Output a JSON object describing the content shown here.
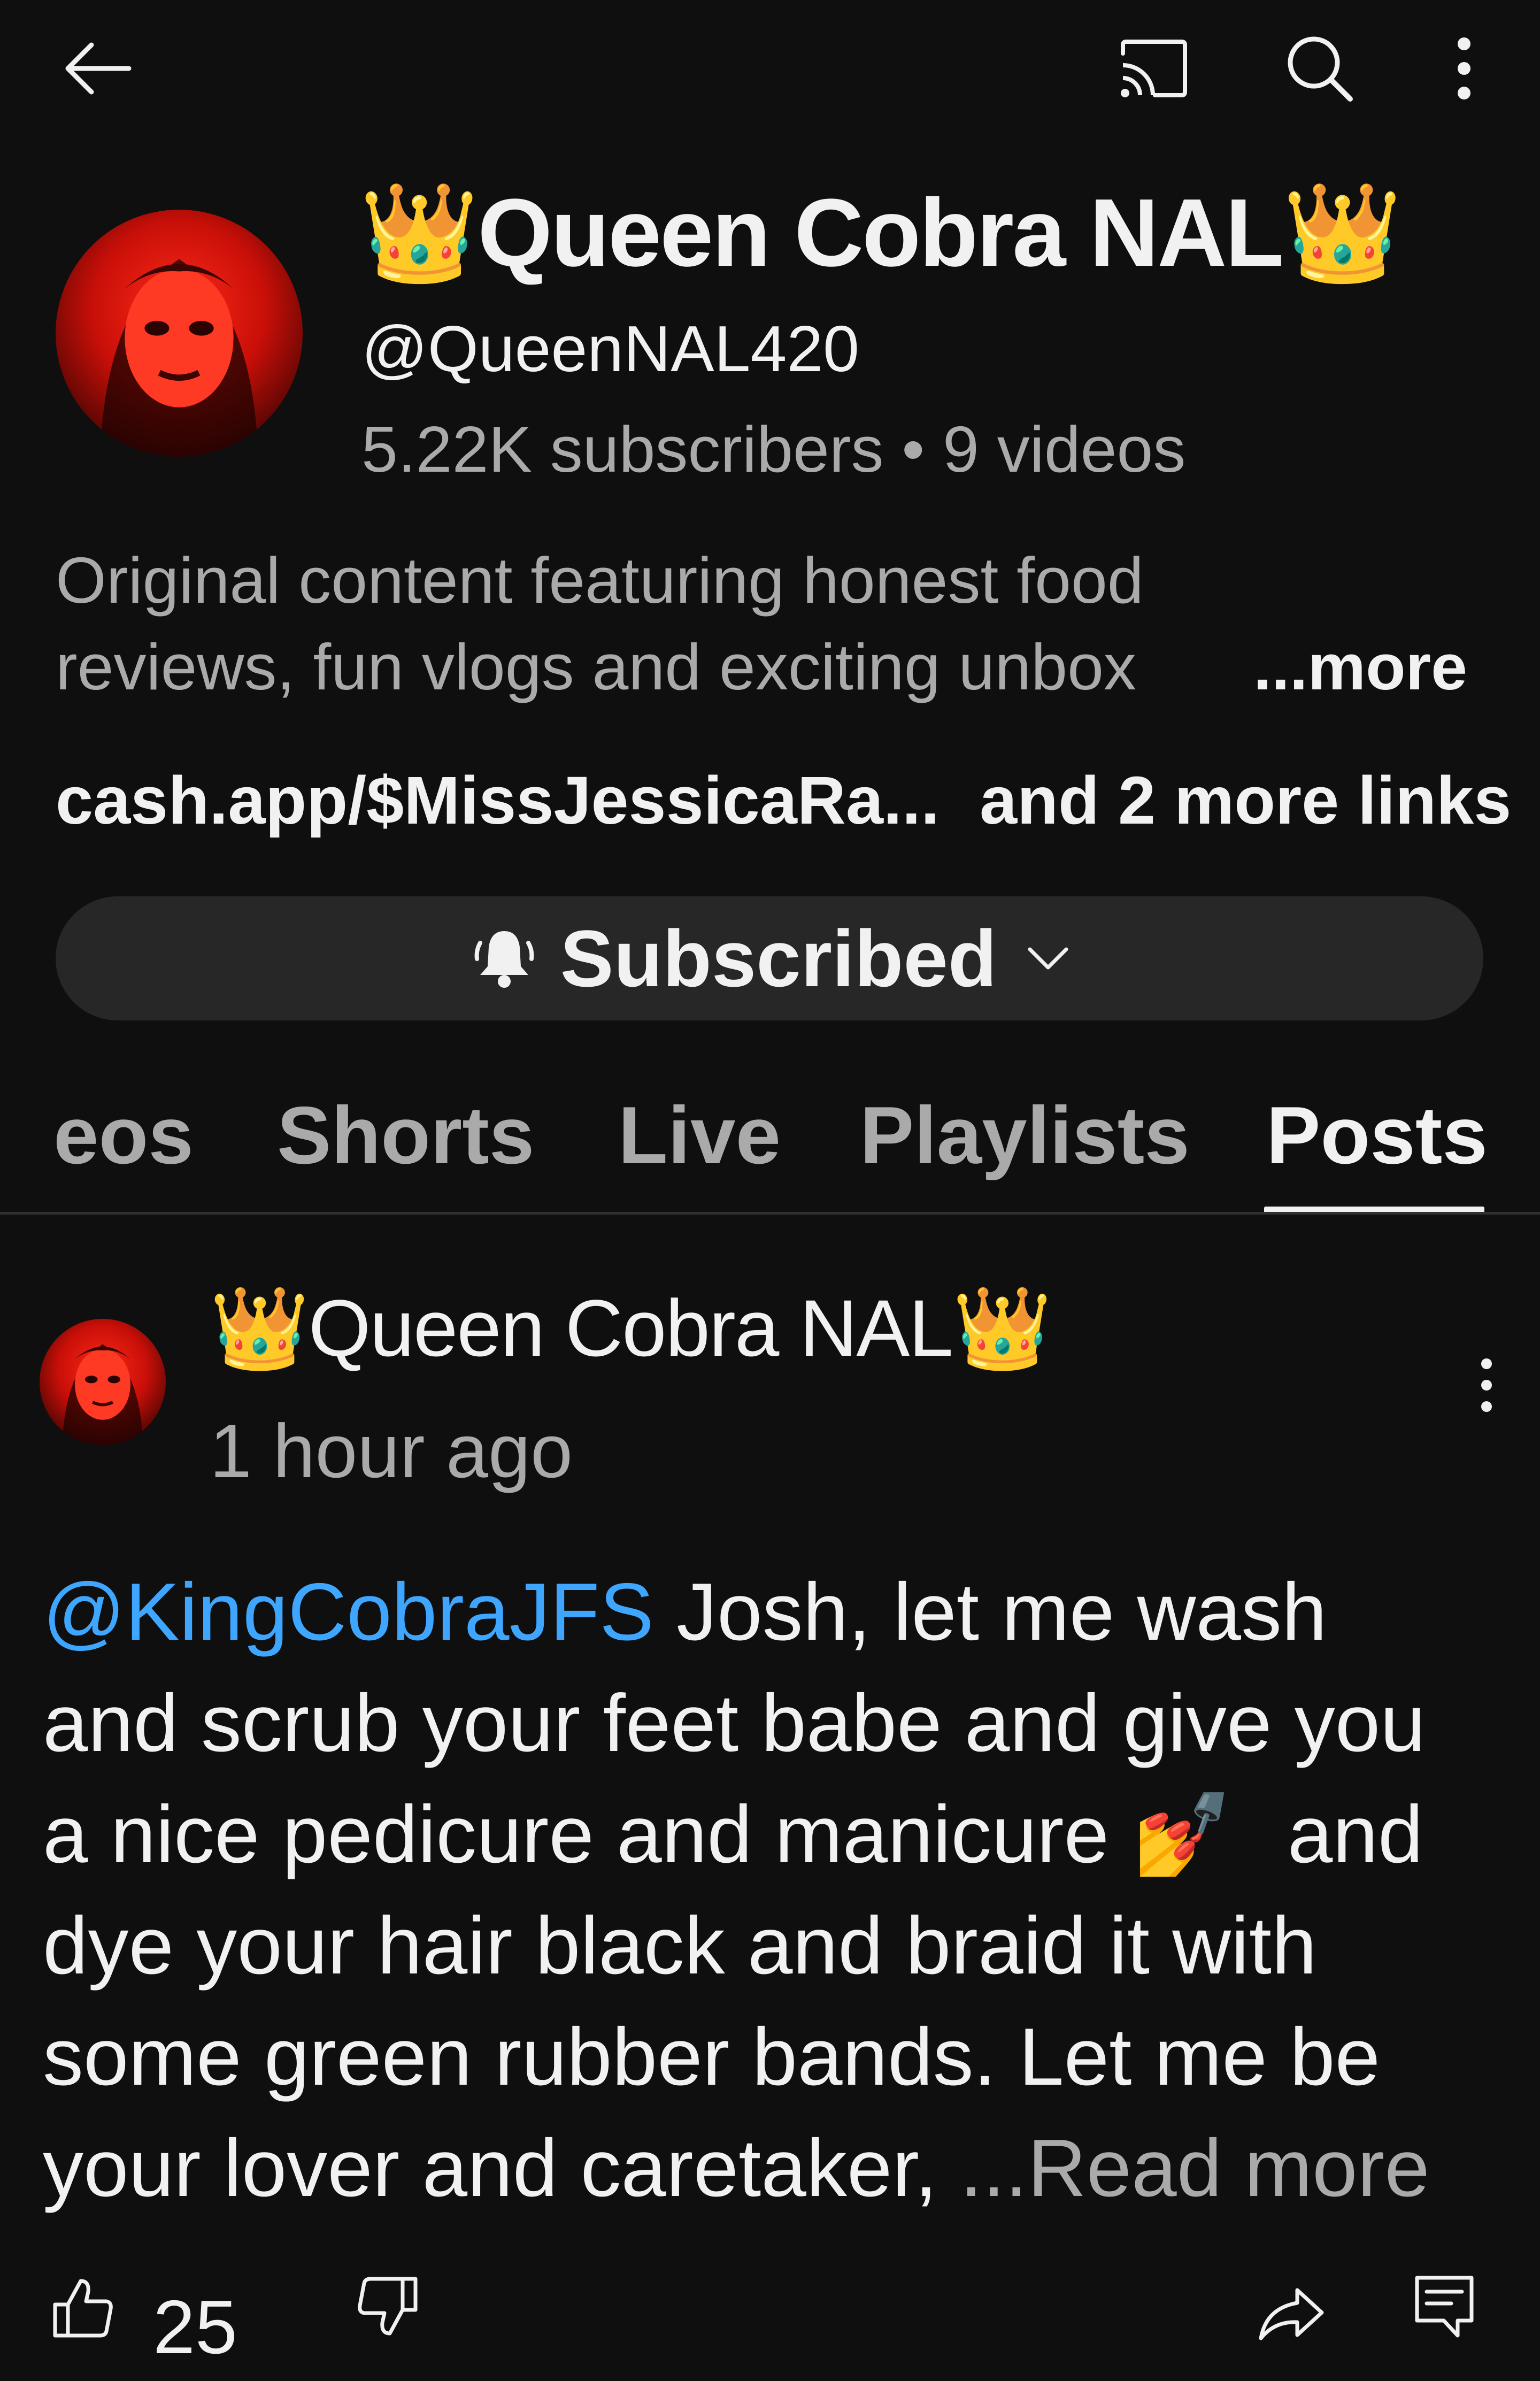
{
  "topbar": {
    "back_icon": "arrow-left-icon",
    "cast_icon": "cast-icon",
    "search_icon": "search-icon",
    "more_icon": "more-vertical-icon"
  },
  "channel": {
    "name": "Queen Cobra NAL",
    "crown_emoji": "👑",
    "handle": "@QueenNAL420",
    "stats": "5.22K subscribers • 9 videos",
    "description_line1": "Original content featuring honest food",
    "description_line2": "reviews, fun vlogs and exciting unbox",
    "description_more": "...more",
    "link_primary": "cash.app/$MissJessicaRa...",
    "link_more": "and 2 more links"
  },
  "subscribe_button": {
    "label": "Subscribed",
    "bell_icon": "bell-ringing-icon",
    "chevron_icon": "chevron-down-icon"
  },
  "tabs": [
    {
      "label": "eos",
      "active": false
    },
    {
      "label": "Shorts",
      "active": false
    },
    {
      "label": "Live",
      "active": false
    },
    {
      "label": "Playlists",
      "active": false
    },
    {
      "label": "Posts",
      "active": true
    }
  ],
  "post": {
    "author": "Queen Cobra NAL",
    "crown_emoji": "👑",
    "time": "1 hour ago",
    "mention": "@KingCobraJFS",
    "line1_text": " Josh, let me wash",
    "line2": "and scrub your feet babe and give you",
    "line3_a": "a nice pedicure and manicure ",
    "nail_emoji": "💅",
    "line3_b": " and",
    "line4": "dye your hair black and braid it with",
    "line5": "some green rubber bands. Let me be",
    "line6_text": "your lover and caretaker, ",
    "read_more": "...Read more",
    "likes": "25",
    "actions": {
      "like_icon": "thumbs-up-icon",
      "dislike_icon": "thumbs-down-icon",
      "share_icon": "share-icon",
      "comment_icon": "comment-icon",
      "menu_icon": "more-vertical-icon"
    }
  },
  "colors": {
    "background": "#0f0f0f",
    "text_primary": "#f1f1f1",
    "text_secondary": "#aaaaaa",
    "mention": "#3ea6ff",
    "button_bg": "#272727",
    "avatar_red": "#d01208"
  }
}
